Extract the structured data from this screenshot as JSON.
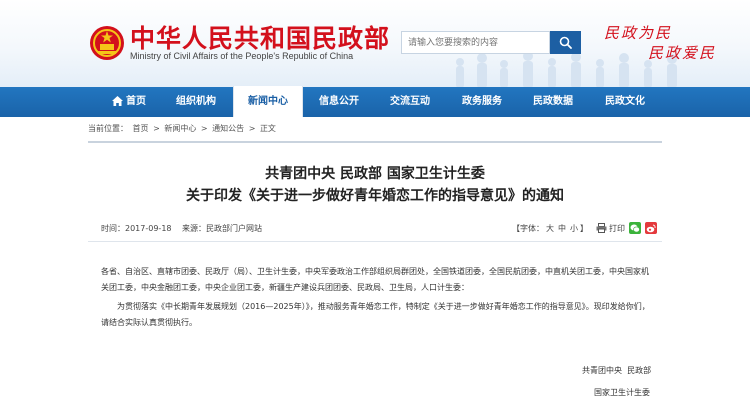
{
  "header": {
    "title": "中华人民共和国民政部",
    "subtitle": "Ministry of Civil Affairs of the People's Republic of China",
    "search_placeholder": "请输入您要搜索的内容",
    "slogan_1": "民政为民",
    "slogan_2": "民政爱民",
    "colors": {
      "title_red": "#d3101c",
      "nav_blue": "#1a63a9",
      "search_blue": "#1d5fa3"
    }
  },
  "nav": {
    "items": [
      {
        "label": "首页",
        "icon": "home-icon"
      },
      {
        "label": "组织机构"
      },
      {
        "label": "新闻中心",
        "active": true
      },
      {
        "label": "信息公开"
      },
      {
        "label": "交流互动"
      },
      {
        "label": "政务服务"
      },
      {
        "label": "民政数据"
      },
      {
        "label": "民政文化"
      }
    ]
  },
  "breadcrumb": {
    "prefix": "当前位置：",
    "items": [
      "首页",
      "新闻中心",
      "通知公告",
      "正文"
    ],
    "separator": ">"
  },
  "article": {
    "title_line1": "共青团中央 民政部 国家卫生计生委",
    "title_line2": "关于印发《关于进一步做好青年婚恋工作的指导意见》的通知",
    "time_label": "时间：",
    "time": "2017-09-18",
    "source_label": "来源：",
    "source": "民政部门户网站",
    "font_label": "【字体：",
    "font_large": "大",
    "font_medium": "中",
    "font_small": "小",
    "font_close": "】",
    "print_label": "打印",
    "paragraph_1": "各省、自治区、直辖市团委、民政厅（局）、卫生计生委，中央军委政治工作部组织局群团处，全国铁道团委，全国民航团委，中直机关团工委，中央国家机关团工委，中央金融团工委，中央企业团工委，新疆生产建设兵团团委、民政局、卫生局，人口计生委：",
    "paragraph_2": "为贯彻落实《中长期青年发展规划（2016—2025年）》，推动服务青年婚恋工作，特制定《关于进一步做好青年婚恋工作的指导意见》。现印发给你们，请结合实际认真贯彻执行。",
    "signatory_1": "共青团中央  民政部",
    "signatory_2": "国家卫生计生委"
  }
}
